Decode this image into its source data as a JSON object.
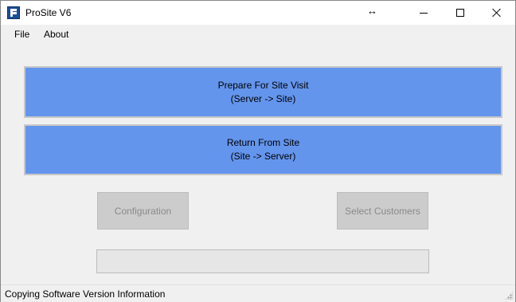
{
  "window": {
    "title": "ProSite V6",
    "icon": "prosite-app-icon",
    "controls": {
      "minimize": "minimize-icon",
      "maximize": "maximize-icon",
      "close": "close-icon"
    }
  },
  "menu": {
    "file": "File",
    "about": "About"
  },
  "actions": {
    "prepare": {
      "line1": "Prepare For Site Visit",
      "line2": "(Server -> Site)"
    },
    "return": {
      "line1": "Return From Site",
      "line2": "(Site -> Server)"
    },
    "configuration": "Configuration",
    "select_customers": "Select Customers"
  },
  "progress": {
    "value": 0
  },
  "status": {
    "text": "Copying Software Version Information"
  },
  "colors": {
    "accent_button": "#6495ed",
    "disabled_button": "#cccccc",
    "window_bg": "#f0f0f0"
  }
}
